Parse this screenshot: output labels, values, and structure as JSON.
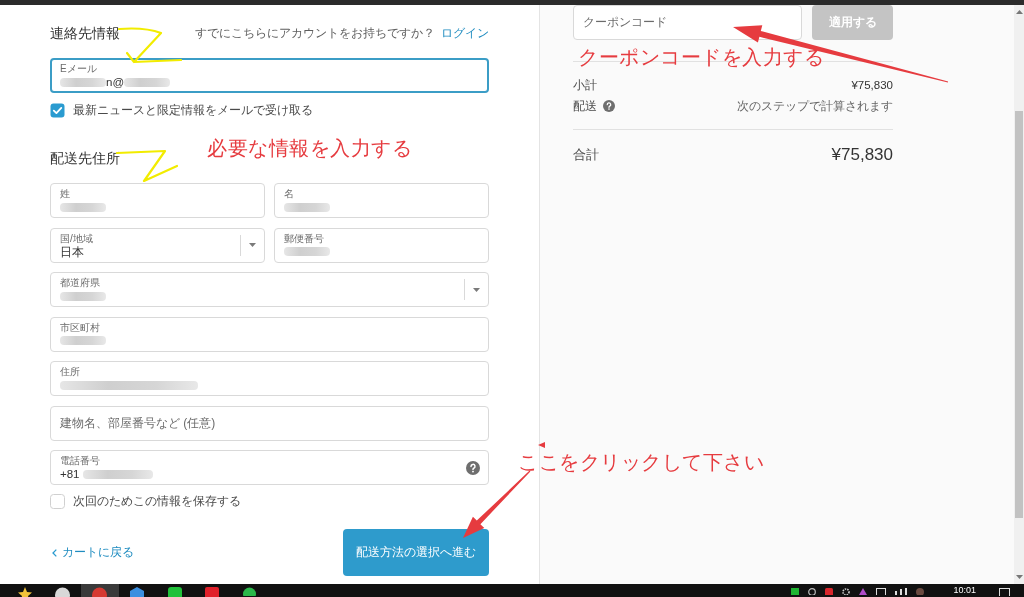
{
  "contact": {
    "heading": "連絡先情報",
    "account_prompt": "すでにこちらにアカウントをお持ちですか？",
    "login_link": "ログイン",
    "email": {
      "kind": "text",
      "label": "Eメール",
      "value": [
        {
          "kind": "blur"
        },
        {
          "kind": "text",
          "text": "n@"
        },
        {
          "kind": "blur"
        }
      ],
      "focused": true
    },
    "newsletter": {
      "label": "最新ニュースと限定情報をメールで受け取る",
      "checked": true
    }
  },
  "shipping": {
    "heading": "配送先住所",
    "note": "必要な情報を入力する",
    "rows": [
      [
        {
          "kind": "text",
          "label": "姓",
          "value": [
            {
              "kind": "blur"
            }
          ]
        },
        {
          "kind": "text",
          "label": "名",
          "value": [
            {
              "kind": "blur"
            }
          ]
        }
      ],
      [
        {
          "kind": "select",
          "label": "国/地域",
          "value": [
            {
              "kind": "text",
              "text": "日本"
            }
          ]
        },
        {
          "kind": "text",
          "label": "郵便番号",
          "value": [
            {
              "kind": "blur"
            }
          ]
        }
      ],
      [
        {
          "kind": "select",
          "label": "都道府県",
          "value": [
            {
              "kind": "blur"
            }
          ]
        }
      ],
      [
        {
          "kind": "text",
          "label": "市区町村",
          "value": [
            {
              "kind": "blur"
            }
          ]
        }
      ],
      [
        {
          "kind": "text",
          "label": "住所",
          "value": [
            {
              "kind": "longblur"
            }
          ]
        }
      ],
      [
        {
          "kind": "placeholder",
          "placeholder": "建物名、部屋番号など (任意)"
        }
      ],
      [
        {
          "kind": "help",
          "label": "電話番号",
          "value": [
            {
              "kind": "text",
              "text": "+81"
            },
            {
              "kind": "wideblur"
            }
          ]
        }
      ]
    ],
    "save_info": {
      "label": "次回のためこの情報を保存する",
      "checked": false
    }
  },
  "footer": {
    "back_link": "カートに戻る",
    "continue_button": "配送方法の選択へ進む",
    "note": "ここをクリックして下さい"
  },
  "summary": {
    "coupon": {
      "placeholder": "クーポンコード",
      "button": "適用する",
      "button_disabled": true,
      "note": "クーポンコードを入力する"
    },
    "lines": [
      {
        "kind": "amount",
        "label": "小計",
        "value": "¥75,830",
        "help": false
      },
      {
        "kind": "note",
        "label": "配送",
        "value": "次のステップで計算されます",
        "help": true
      }
    ],
    "total": {
      "label": "合計",
      "value": "¥75,830"
    }
  },
  "taskbar": {
    "clock": "10:01"
  }
}
